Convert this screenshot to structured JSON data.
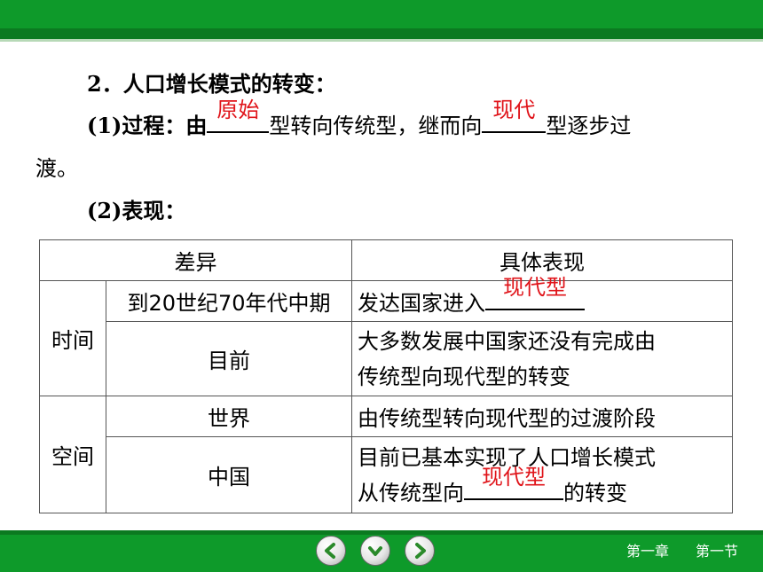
{
  "heading": "2．人口增长模式的转变：",
  "process": {
    "label": "(1)过程：由",
    "blank1_answer": "原始",
    "mid": "型转向传统型，继而向",
    "blank2_answer": "现代",
    "end": "型逐步过",
    "wrap": "渡。"
  },
  "performance_label": "(2)表现：",
  "table": {
    "header_diff": "差异",
    "header_detail": "具体表现",
    "time_label": "时间",
    "space_label": "空间",
    "row1_sub": "到20世纪70年代中期",
    "row1_detail_prefix": "发达国家进入",
    "row1_answer": "现代型",
    "row2_sub": "目前",
    "row2_detail_line1": "大多数发展中国家还没有完成由",
    "row2_detail_line2": "传统型向现代型的转变",
    "row3_sub": "世界",
    "row3_detail": "由传统型转向现代型的过渡阶段",
    "row4_sub": "中国",
    "row4_detail_line1": "目前已基本实现了人口增长模式",
    "row4_detail_prefix": "从传统型向",
    "row4_answer": "现代型",
    "row4_detail_suffix": "的转变"
  },
  "footer": {
    "chapter": "第一章",
    "section": "第一节",
    "icons": [
      "arrow-left-icon",
      "arrow-down-icon",
      "arrow-right-icon"
    ]
  },
  "colors": {
    "bar_green": "#0e9a2a",
    "answer_red": "#e0141a"
  }
}
